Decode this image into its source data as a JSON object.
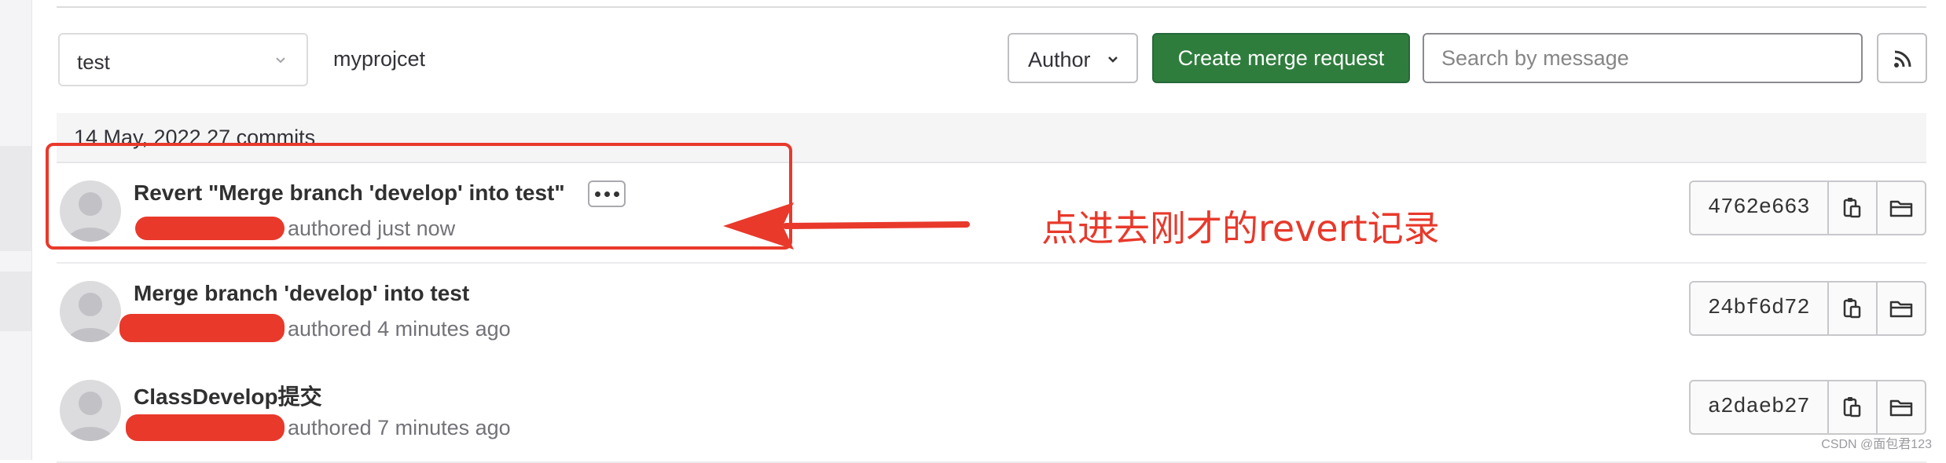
{
  "filters": {
    "branch": "test",
    "project": "myprojcet",
    "author_label": "Author",
    "create_merge_request_label": "Create merge request",
    "search_placeholder": "Search by message"
  },
  "date_header": "14 May, 2022 27 commits",
  "commits": [
    {
      "title": "Revert \"Merge branch 'develop' into test\"",
      "authored": "authored just now",
      "sha": "4762e663",
      "has_more_button": true
    },
    {
      "title": "Merge branch 'develop' into test",
      "authored": "authored 4 minutes ago",
      "sha": "24bf6d72",
      "has_more_button": false
    },
    {
      "title": "ClassDevelop提交",
      "authored": "authored 7 minutes ago",
      "sha": "a2daeb27",
      "has_more_button": false
    }
  ],
  "annotation": "点进去刚才的revert记录",
  "watermark": "CSDN @面包君123",
  "colors": {
    "primary_green": "#2f7d3d",
    "annotation_red": "#e8392b",
    "avatar_gray": "#dcdcde"
  },
  "icons": {
    "copy": "clipboard-icon",
    "browse": "folder-icon",
    "feed": "rss-icon",
    "dropdown": "chevron-down-icon"
  }
}
